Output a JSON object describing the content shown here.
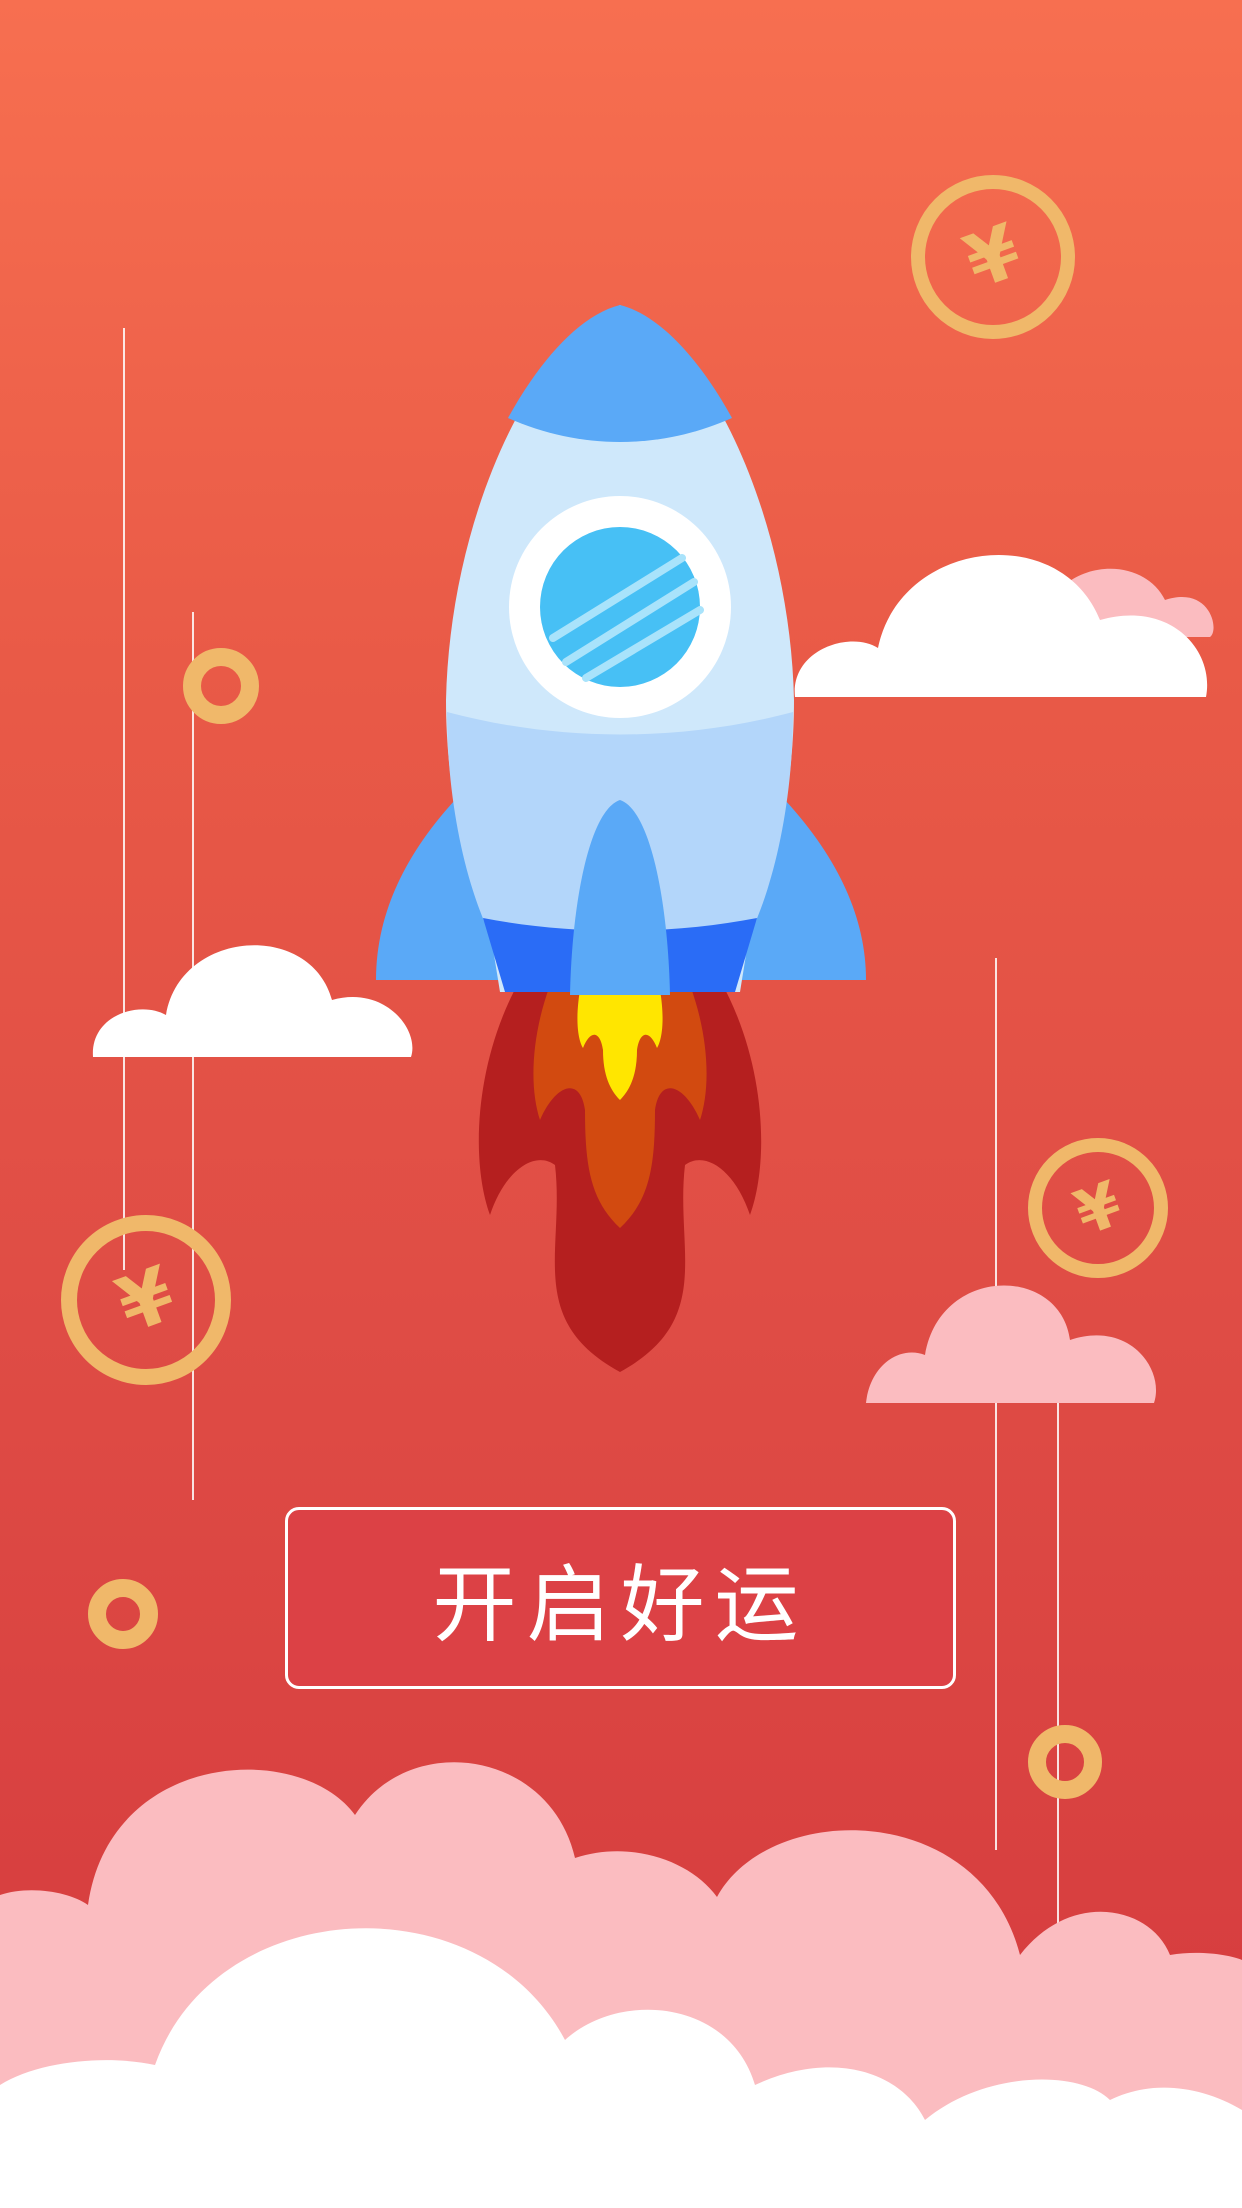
{
  "app": {
    "cta_label": "开启好运",
    "coin_symbol": "¥"
  },
  "colors": {
    "bg_top": "#f76f50",
    "bg_bottom": "#d4393d",
    "cta_fill": "#dc4145",
    "coin": "#f0b86a",
    "rocket_blue": "#5aa9f7",
    "rocket_body": "#cfe8fb",
    "flame_outer": "#b51f1f",
    "flame_mid": "#d24a10",
    "flame_core": "#ffe600",
    "cloud_white": "#ffffff",
    "cloud_pink": "#fbbcc0"
  },
  "icons": [
    "rocket-icon",
    "yuan-coin-icon",
    "ring-icon",
    "cloud-icon"
  ]
}
